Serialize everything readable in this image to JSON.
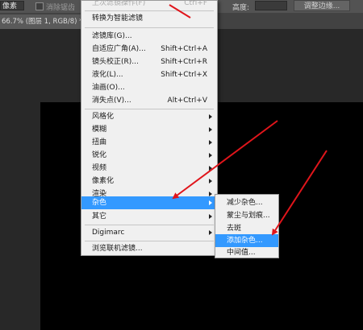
{
  "options_bar": {
    "feather_value": "像素",
    "antialias_label": "消除锯齿",
    "height_label": "高度:",
    "refine_edge_label": "调整边缘..."
  },
  "document_tab": {
    "title": "66.7% (图层 1, RGB/8) *"
  },
  "filter_menu": {
    "last_filter": {
      "label": "上次滤镜操作(F)",
      "shortcut": "Ctrl+F"
    },
    "convert_smart": "转换为智能滤镜",
    "filter_gallery": "滤镜库(G)...",
    "adaptive_wide": {
      "label": "自适应广角(A)...",
      "shortcut": "Shift+Ctrl+A"
    },
    "lens_correction": {
      "label": "镜头校正(R)...",
      "shortcut": "Shift+Ctrl+R"
    },
    "liquify": {
      "label": "液化(L)...",
      "shortcut": "Shift+Ctrl+X"
    },
    "oil_paint": "油画(O)...",
    "vanishing_point": {
      "label": "消失点(V)...",
      "shortcut": "Alt+Ctrl+V"
    },
    "stylize": "风格化",
    "blur": "模糊",
    "distort": "扭曲",
    "sharpen": "锐化",
    "video": "视频",
    "pixelate": "像素化",
    "render": "渲染",
    "noise": "杂色",
    "other": "其它",
    "digimarc": "Digimarc",
    "browse_online": "浏览联机滤镜..."
  },
  "noise_submenu": {
    "reduce_noise": "减少杂色...",
    "dust_scratches": "蒙尘与划痕...",
    "despeckle": "去斑",
    "add_noise": "添加杂色...",
    "median": "中间值..."
  },
  "colors": {
    "highlight": "#3399ff",
    "annotation_arrow": "#e0151b"
  }
}
